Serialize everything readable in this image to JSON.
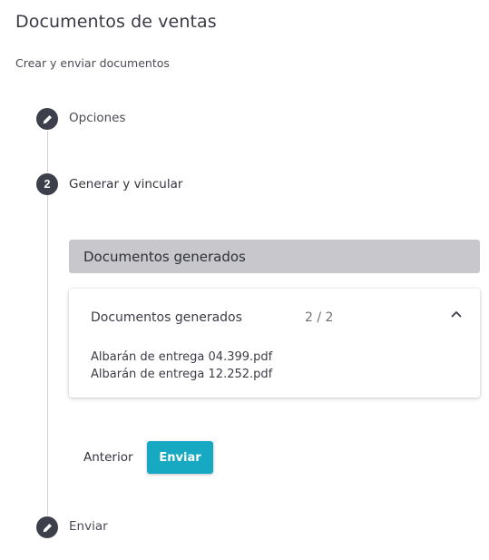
{
  "header": {
    "title": "Documentos de ventas",
    "subtitle": "Crear y enviar documentos"
  },
  "steps": [
    {
      "label": "Opciones",
      "icon": "pencil-icon",
      "state": "edit"
    },
    {
      "label": "Generar y vincular",
      "number": "2",
      "state": "active"
    },
    {
      "label": "Enviar",
      "icon": "pencil-icon",
      "state": "edit"
    }
  ],
  "section": {
    "title": "Documentos generados"
  },
  "card": {
    "title": "Documentos generados",
    "count": "2 / 2",
    "toggle_icon": "chevron-up-icon",
    "files": [
      "Albarán de entrega 04.399.pdf",
      "Albarán de entrega 12.252.pdf"
    ]
  },
  "actions": {
    "prev_label": "Anterior",
    "send_label": "Enviar"
  },
  "colors": {
    "step_icon_bg": "#3d3f4a",
    "primary_button": "#17a9c2",
    "section_bar": "#c8c8cc"
  }
}
